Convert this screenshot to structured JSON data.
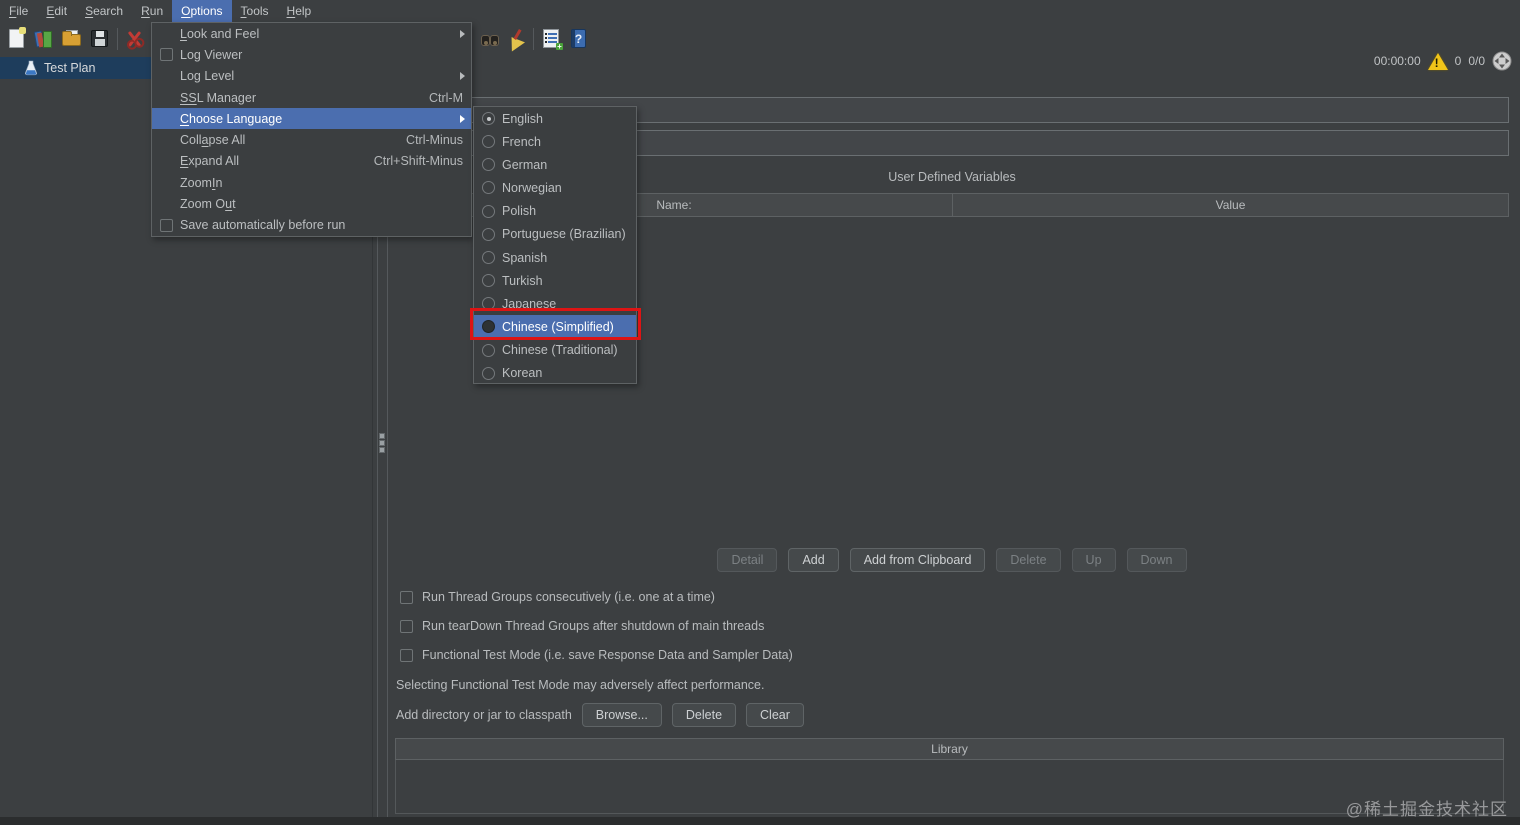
{
  "colors": {
    "background": "#3c3f41",
    "accent_blue": "#4b6eaf",
    "tree_selection": "#1e3d5c",
    "annotation_red": "#dd1414",
    "header_bg": "#46494b"
  },
  "menu_bar": {
    "items": [
      {
        "pre": "",
        "u": "F",
        "post": "ile"
      },
      {
        "pre": "",
        "u": "E",
        "post": "dit"
      },
      {
        "pre": "",
        "u": "S",
        "post": "earch"
      },
      {
        "pre": "",
        "u": "R",
        "post": "un"
      },
      {
        "pre": "",
        "u": "O",
        "post": "ptions",
        "active": true
      },
      {
        "pre": "",
        "u": "T",
        "post": "ools"
      },
      {
        "pre": "",
        "u": "H",
        "post": "elp"
      }
    ]
  },
  "toolbar": {
    "icons": [
      "new-file",
      "templates",
      "open",
      "save",
      "cut",
      "search",
      "clean",
      "function-helper",
      "help"
    ]
  },
  "status": {
    "timer": "00:00:00",
    "error_count": "0",
    "threads": "0/0"
  },
  "tree": {
    "items": [
      {
        "label": "Test Plan",
        "selected": true
      }
    ]
  },
  "options_menu": {
    "items": [
      {
        "pre": "",
        "u": "L",
        "post": "ook and Feel",
        "submenu": true
      },
      {
        "pre": "Log Viewer",
        "u": "",
        "post": "",
        "checkbox": true,
        "checked": false
      },
      {
        "pre": "Log Level",
        "u": "",
        "post": "",
        "submenu": true
      },
      {
        "pre": "",
        "u": "SS",
        "post": "L Manager",
        "shortcut": "Ctrl-M"
      },
      {
        "pre": "",
        "u": "C",
        "post": "hoose Language",
        "submenu": true,
        "highlighted": true
      },
      {
        "pre": "Coll",
        "u": "a",
        "post": "pse All",
        "shortcut": "Ctrl-Minus"
      },
      {
        "pre": "",
        "u": "E",
        "post": "xpand All",
        "shortcut": "Ctrl+Shift-Minus"
      },
      {
        "pre": "Zoom ",
        "u": "I",
        "post": "n"
      },
      {
        "pre": "Zoom O",
        "u": "u",
        "post": "t"
      },
      {
        "pre": "Save automatically before run",
        "u": "",
        "post": "",
        "checkbox": true,
        "checked": false
      }
    ]
  },
  "language_menu": {
    "items": [
      {
        "label": "English",
        "selected": true
      },
      {
        "label": "French"
      },
      {
        "label": "German"
      },
      {
        "label": "Norwegian"
      },
      {
        "label": "Polish"
      },
      {
        "label": "Portuguese (Brazilian)"
      },
      {
        "label": "Spanish"
      },
      {
        "label": "Turkish"
      },
      {
        "label": "Japanese"
      },
      {
        "label": "Chinese (Simplified)",
        "highlighted": true,
        "annotated": true
      },
      {
        "label": "Chinese (Traditional)"
      },
      {
        "label": "Korean"
      }
    ]
  },
  "panel": {
    "name_value": "",
    "comments_value": "",
    "udv_title": "User Defined Variables",
    "table_columns": [
      "Name:",
      "Value"
    ],
    "action_buttons": [
      {
        "label": "Detail",
        "disabled": true
      },
      {
        "label": "Add",
        "disabled": false
      },
      {
        "label": "Add from Clipboard",
        "disabled": false
      },
      {
        "label": "Delete",
        "disabled": true
      },
      {
        "label": "Up",
        "disabled": true
      },
      {
        "label": "Down",
        "disabled": true
      }
    ],
    "checkboxes": [
      {
        "label": "Run Thread Groups consecutively (i.e. one at a time)",
        "checked": false
      },
      {
        "label": "Run tearDown Thread Groups after shutdown of main threads",
        "checked": false
      },
      {
        "label": "Functional Test Mode (i.e. save Response Data and Sampler Data)",
        "checked": false
      }
    ],
    "note": "Selecting Functional Test Mode may adversely affect performance.",
    "classpath_label": "Add directory or jar to classpath",
    "classpath_buttons": [
      "Browse...",
      "Delete",
      "Clear"
    ],
    "library_title": "Library"
  },
  "watermark": "@稀土掘金技术社区"
}
